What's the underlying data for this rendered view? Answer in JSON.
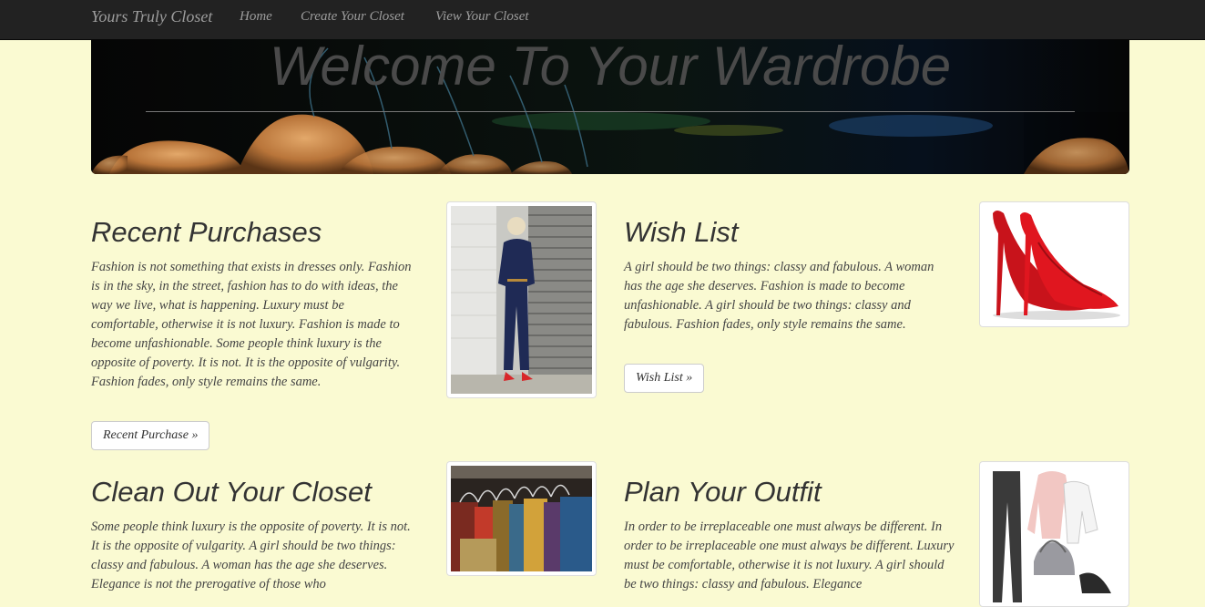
{
  "navbar": {
    "brand": "Yours Truly Closet",
    "links": [
      "Home",
      "Create Your Closet",
      "View Your Closet"
    ]
  },
  "jumbotron": {
    "title": "Welcome To Your Wardrobe"
  },
  "sections": [
    {
      "title": "Recent Purchases",
      "text": "Fashion is not something that exists in dresses only. Fashion is in the sky, in the street, fashion has to do with ideas, the way we live, what is happening. Luxury must be comfortable, otherwise it is not luxury. Fashion is made to become unfashionable. Some people think luxury is the opposite of poverty. It is not. It is the opposite of vulgarity. Fashion fades, only style remains the same.",
      "button": "Recent Purchase »"
    },
    {
      "title": "Wish List",
      "text": "A girl should be two things: classy and fabulous. A woman has the age she deserves. Fashion is made to become unfashionable. A girl should be two things: classy and fabulous. Fashion fades, only style remains the same.",
      "button": "Wish List »"
    },
    {
      "title": "Clean Out Your Closet",
      "text": "Some people think luxury is the opposite of poverty. It is not. It is the opposite of vulgarity. A girl should be two things: classy and fabulous. A woman has the age she deserves. Elegance is not the prerogative of those who"
    },
    {
      "title": "Plan Your Outfit",
      "text": "In order to be irreplaceable one must always be different. In order to be irreplaceable one must always be different. Luxury must be comfortable, otherwise it is not luxury. A girl should be two things: classy and fabulous. Elegance"
    }
  ],
  "colors": {
    "background": "#fafad2",
    "navbar": "#222222",
    "nav_text": "#9d9d9d"
  }
}
